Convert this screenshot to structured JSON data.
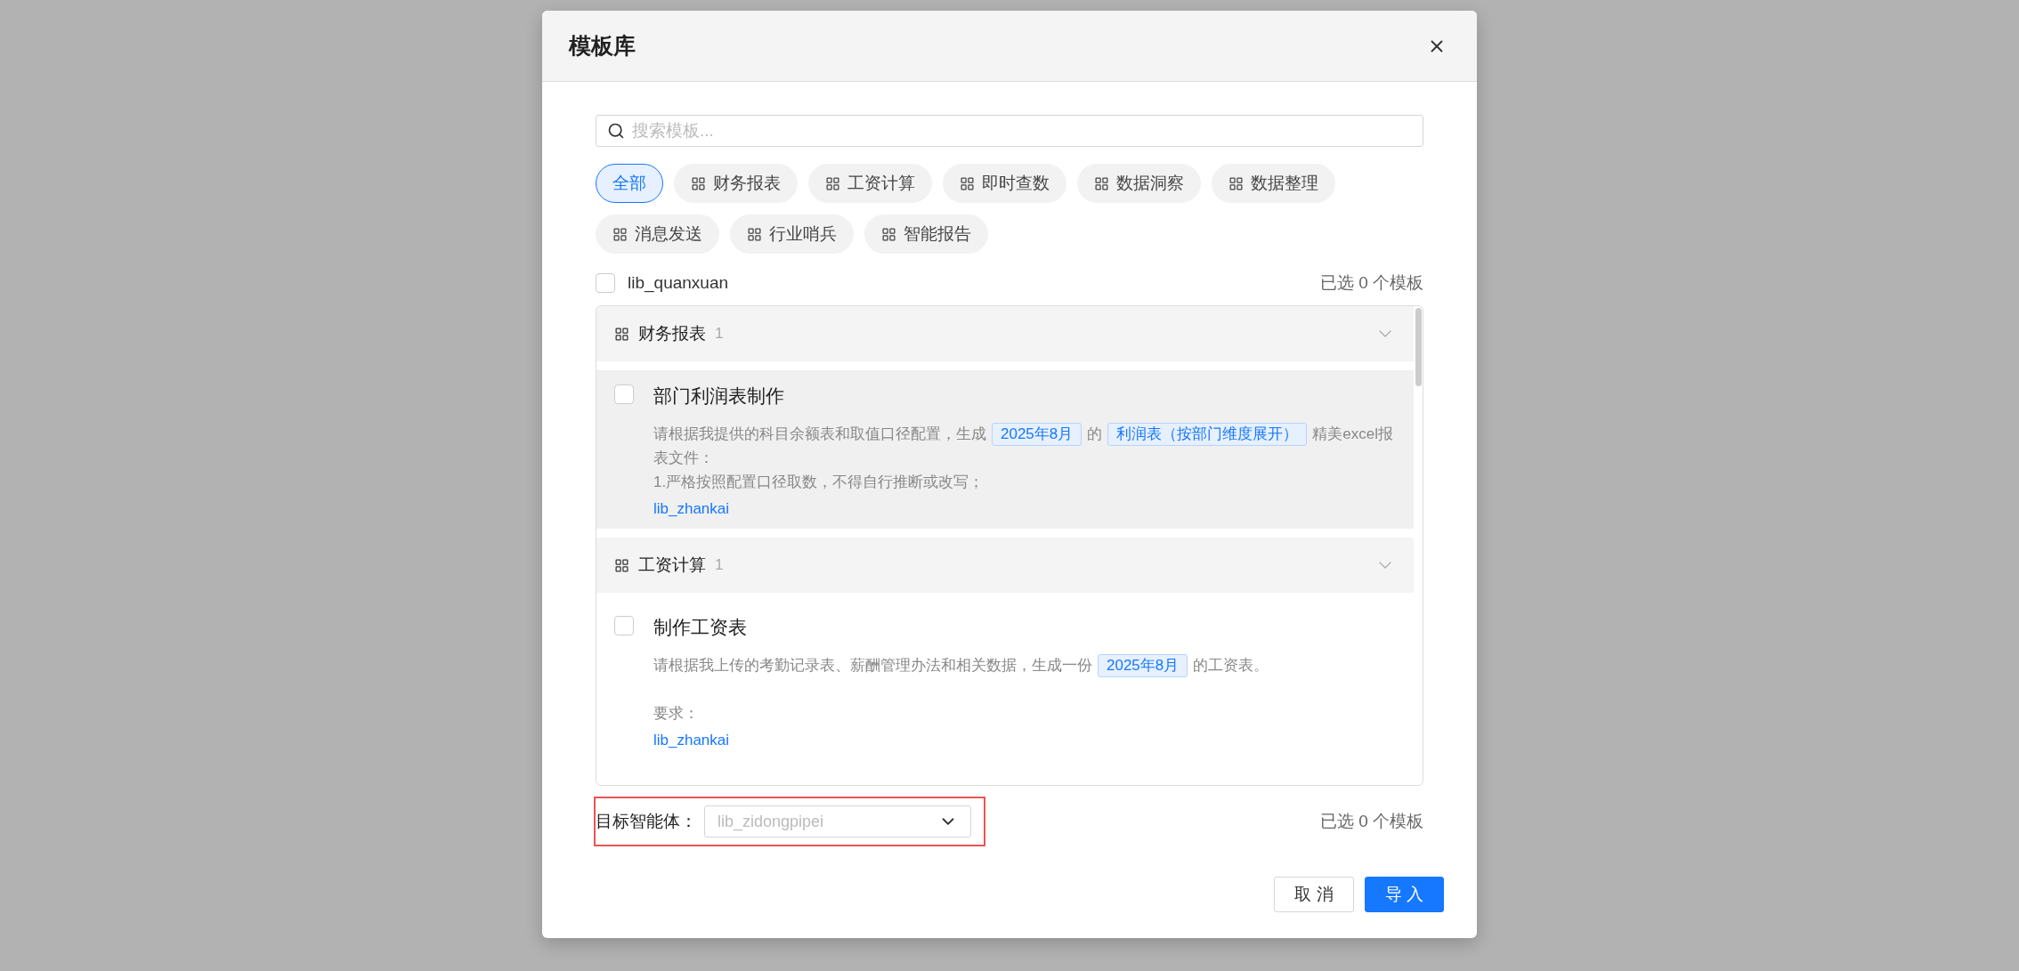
{
  "dialog": {
    "title": "模板库",
    "search": {
      "placeholder": "搜索模板..."
    },
    "categories": [
      {
        "label": "全部",
        "selected": true,
        "icon": false
      },
      {
        "label": "财务报表",
        "selected": false,
        "icon": true
      },
      {
        "label": "工资计算",
        "selected": false,
        "icon": true
      },
      {
        "label": "即时查数",
        "selected": false,
        "icon": true
      },
      {
        "label": "数据洞察",
        "selected": false,
        "icon": true
      },
      {
        "label": "数据整理",
        "selected": false,
        "icon": true
      },
      {
        "label": "消息发送",
        "selected": false,
        "icon": true
      },
      {
        "label": "行业哨兵",
        "selected": false,
        "icon": true
      },
      {
        "label": "智能报告",
        "selected": false,
        "icon": true
      }
    ],
    "select_all": {
      "label": "lib_quanxuan",
      "checked": false
    },
    "selected_count_top": "已选 0 个模板",
    "groups": [
      {
        "name": "财务报表",
        "count": "1",
        "expanded": true,
        "items": [
          {
            "title": "部门利润表制作",
            "checked": false,
            "highlighted": true,
            "expand_link": "lib_zhankai",
            "paragraphs": [
              {
                "kind": "line",
                "segments": [
                  {
                    "kind": "text",
                    "text": "请根据我提供的科目余额表和取值口径配置，生成"
                  },
                  {
                    "kind": "tag",
                    "text": "2025年8月"
                  },
                  {
                    "kind": "text",
                    "text": "的"
                  },
                  {
                    "kind": "tag",
                    "text": "利润表（按部门维度展开）"
                  },
                  {
                    "kind": "text",
                    "text": "精美excel报表文件："
                  }
                ]
              },
              {
                "kind": "line",
                "segments": [
                  {
                    "kind": "text",
                    "text": "1.严格按照配置口径取数，不得自行推断或改写；"
                  }
                ]
              }
            ]
          }
        ]
      },
      {
        "name": "工资计算",
        "count": "1",
        "expanded": true,
        "items": [
          {
            "title": "制作工资表",
            "checked": false,
            "highlighted": false,
            "expand_link": "lib_zhankai",
            "paragraphs": [
              {
                "kind": "line",
                "segments": [
                  {
                    "kind": "text",
                    "text": "请根据我上传的考勤记录表、薪酬管理办法和相关数据，生成一份"
                  },
                  {
                    "kind": "tag",
                    "text": "2025年8月"
                  },
                  {
                    "kind": "text",
                    "text": "的工资表。"
                  }
                ]
              },
              {
                "kind": "line",
                "gap_before": true,
                "segments": [
                  {
                    "kind": "text",
                    "text": "要求："
                  }
                ]
              }
            ]
          }
        ]
      }
    ],
    "target": {
      "label": "目标智能体：",
      "placeholder": "lib_zidongpipei",
      "highlighted": true
    },
    "selected_count_bottom": "已选 0 个模板",
    "buttons": [
      {
        "label": "取 消",
        "kind": "secondary"
      },
      {
        "label": "导 入",
        "kind": "primary"
      }
    ]
  }
}
